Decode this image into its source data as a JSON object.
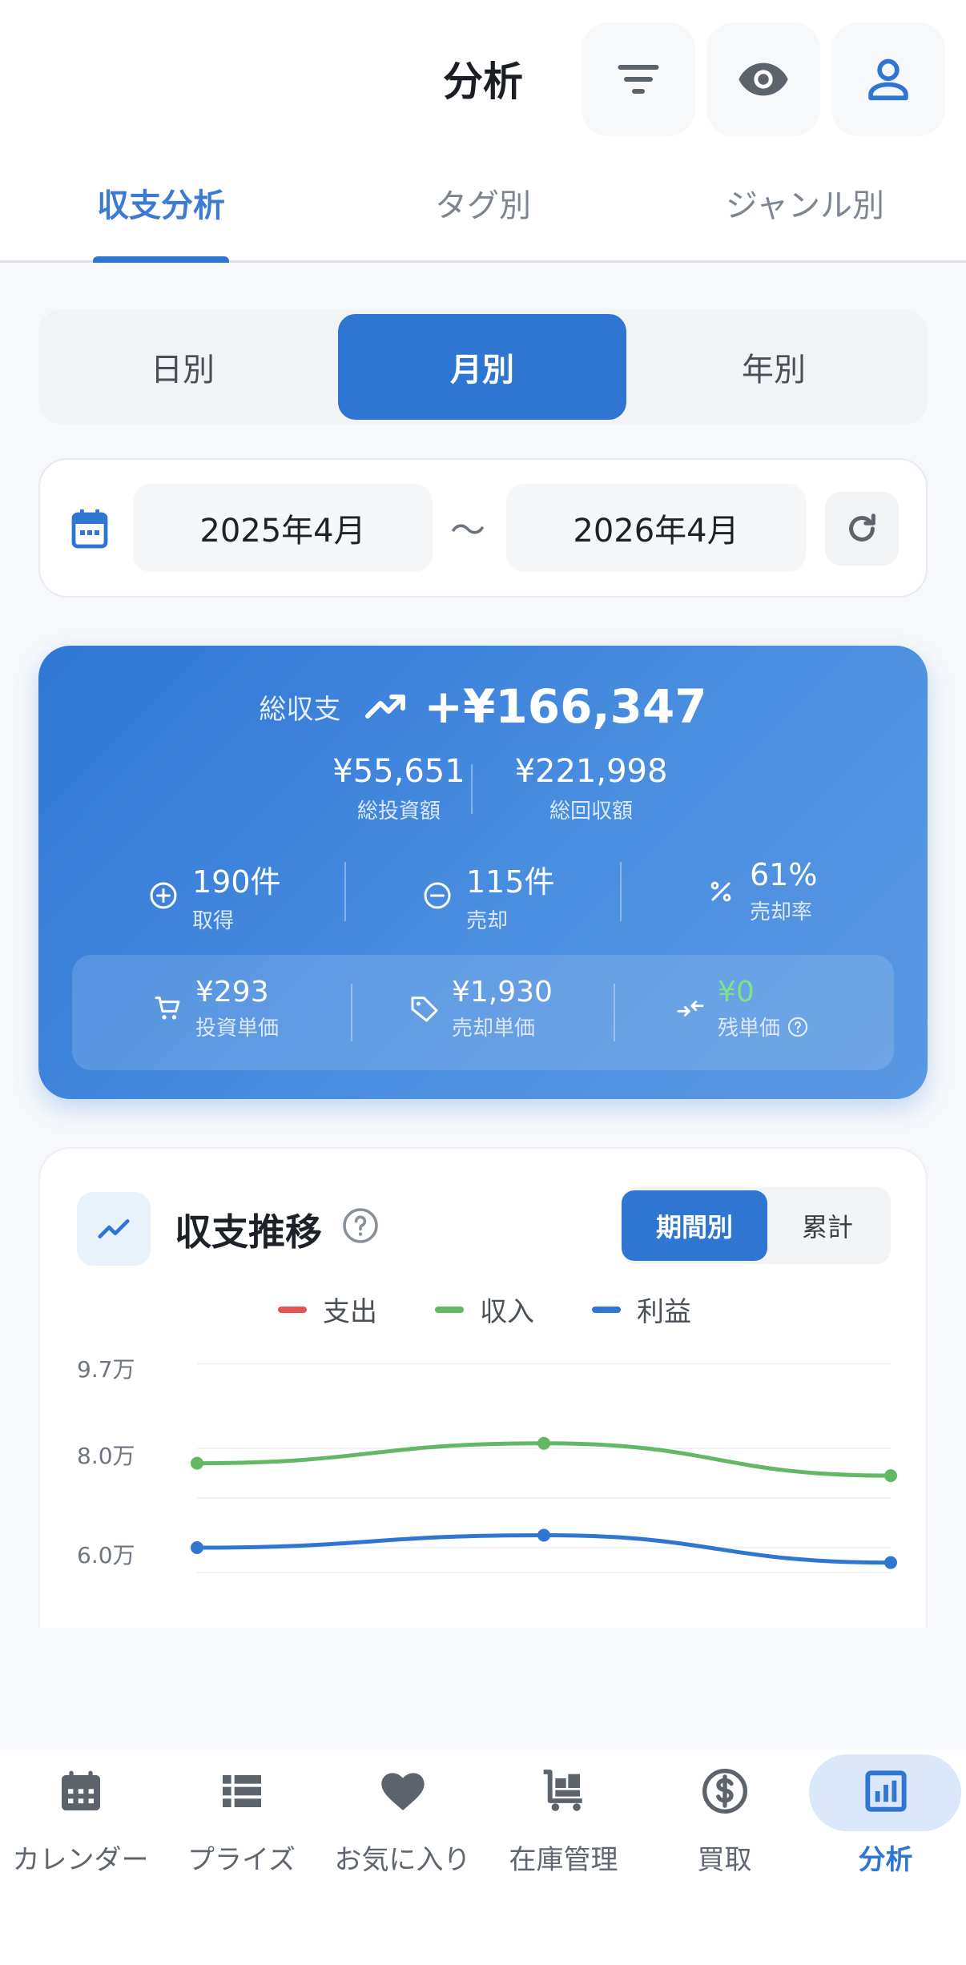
{
  "header": {
    "title": "分析",
    "icons": [
      "filter-icon",
      "eye-icon",
      "user-icon"
    ]
  },
  "tabs": [
    {
      "label": "収支分析",
      "active": true
    },
    {
      "label": "タグ別",
      "active": false
    },
    {
      "label": "ジャンル別",
      "active": false
    }
  ],
  "period": {
    "options": [
      "日別",
      "月別",
      "年別"
    ],
    "selected": "月別"
  },
  "range": {
    "from": "2025年4月",
    "separator": "〜",
    "to": "2026年4月"
  },
  "summary": {
    "total_label": "総収支",
    "total_value": "+¥166,347",
    "invest_value": "¥55,651",
    "invest_label": "総投資額",
    "recover_value": "¥221,998",
    "recover_label": "総回収額",
    "acquired_value": "190件",
    "acquired_label": "取得",
    "sold_value": "115件",
    "sold_label": "売却",
    "rate_value": "61%",
    "rate_label": "売却率",
    "unit_invest_value": "¥293",
    "unit_invest_label": "投資単価",
    "unit_sale_value": "¥1,930",
    "unit_sale_label": "売却単価",
    "remaining_value": "¥0",
    "remaining_label": "残単価",
    "remaining_color": "#7CE38A"
  },
  "chart": {
    "title": "収支推移",
    "toggle": [
      "期間別",
      "累計"
    ],
    "toggle_selected": "期間別",
    "legend": [
      {
        "name": "支出",
        "color": "#E55353"
      },
      {
        "name": "収入",
        "color": "#62B865"
      },
      {
        "name": "利益",
        "color": "#2F76D2"
      }
    ],
    "yticks": [
      "9.7万",
      "8.0万",
      "6.0万"
    ]
  },
  "chart_data": {
    "type": "line",
    "title": "収支推移",
    "ytick_values": [
      97000,
      80000,
      60000
    ],
    "x": [
      0,
      1,
      2
    ],
    "series": [
      {
        "name": "収入",
        "color": "#62B865",
        "values": [
          77000,
          81000,
          74500
        ]
      },
      {
        "name": "利益",
        "color": "#2F76D2",
        "values": [
          60000,
          62500,
          57000
        ]
      }
    ],
    "grid": true,
    "legend_position": "top-center"
  },
  "nav": [
    {
      "label": "カレンダー",
      "icon": "calendar-icon",
      "active": false
    },
    {
      "label": "プライズ",
      "icon": "list-icon",
      "active": false
    },
    {
      "label": "お気に入り",
      "icon": "heart-icon",
      "active": false
    },
    {
      "label": "在庫管理",
      "icon": "cart-icon",
      "active": false
    },
    {
      "label": "買取",
      "icon": "dollar-icon",
      "active": false
    },
    {
      "label": "分析",
      "icon": "chart-icon",
      "active": true
    }
  ]
}
